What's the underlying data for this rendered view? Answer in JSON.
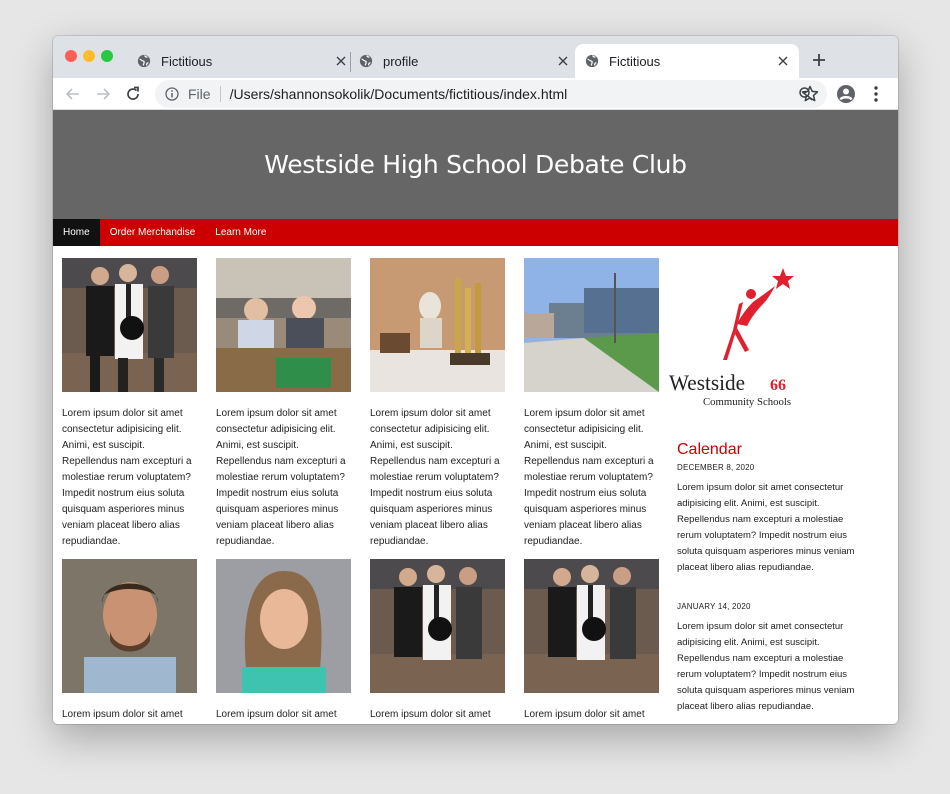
{
  "browser": {
    "tabs": [
      {
        "title": "Fictitious",
        "active": false
      },
      {
        "title": "profile",
        "active": false
      },
      {
        "title": "Fictitious",
        "active": true
      }
    ],
    "address_scheme": "File",
    "url": "/Users/shannonsokolik/Documents/fictitious/index.html"
  },
  "site": {
    "title": "Westside High School Debate Club",
    "nav": [
      {
        "label": "Home",
        "active": true
      },
      {
        "label": "Order Merchandise",
        "active": false
      },
      {
        "label": "Learn More",
        "active": false
      }
    ],
    "cards": [
      {
        "photo": "debate-team-photo",
        "text": "Lorem ipsum dolor sit amet consectetur adipisicing elit. Animi, est suscipit. Repellendus nam excepturi a molestiae rerum voluptatem? Impedit nostrum eius soluta quisquam asperiores minus veniam placeat libero alias repudiandae."
      },
      {
        "photo": "students-at-table-photo",
        "text": "Lorem ipsum dolor sit amet consectetur adipisicing elit. Animi, est suscipit. Repellendus nam excepturi a molestiae rerum voluptatem? Impedit nostrum eius soluta quisquam asperiores minus veniam placeat libero alias repudiandae."
      },
      {
        "photo": "trophies-photo",
        "text": "Lorem ipsum dolor sit amet consectetur adipisicing elit. Animi, est suscipit. Repellendus nam excepturi a molestiae rerum voluptatem? Impedit nostrum eius soluta quisquam asperiores minus veniam placeat libero alias repudiandae."
      },
      {
        "photo": "school-building-photo",
        "text": "Lorem ipsum dolor sit amet consectetur adipisicing elit. Animi, est suscipit. Repellendus nam excepturi a molestiae rerum voluptatem? Impedit nostrum eius soluta quisquam asperiores minus veniam placeat libero alias repudiandae."
      },
      {
        "photo": "man-portrait-photo",
        "text": "Lorem ipsum dolor sit amet"
      },
      {
        "photo": "woman-portrait-photo",
        "text": "Lorem ipsum dolor sit amet"
      },
      {
        "photo": "debate-team-photo",
        "text": "Lorem ipsum dolor sit amet"
      },
      {
        "photo": "debate-team-photo",
        "text": "Lorem ipsum dolor sit amet"
      }
    ],
    "logo": {
      "line1": "Westside",
      "line2": "Community Schools",
      "mark": "66"
    },
    "calendar": {
      "title": "Calendar",
      "events": [
        {
          "date": "DECEMBER 8, 2020",
          "text": "Lorem ipsum dolor sit amet consectetur adipisicing elit. Animi, est suscipit. Repellendus nam excepturi a molestiae rerum voluptatem? Impedit nostrum eius soluta quisquam asperiores minus veniam placeat libero alias repudiandae."
        },
        {
          "date": "JANUARY 14, 2020",
          "text": "Lorem ipsum dolor sit amet consectetur adipisicing elit. Animi, est suscipit. Repellendus nam excepturi a molestiae rerum voluptatem? Impedit nostrum eius soluta quisquam asperiores minus veniam placeat libero alias repudiandae."
        }
      ]
    }
  },
  "colors": {
    "header_bg": "#666666",
    "nav_bg": "#cc0000",
    "nav_active_bg": "#111111",
    "accent": "#cc0000"
  }
}
